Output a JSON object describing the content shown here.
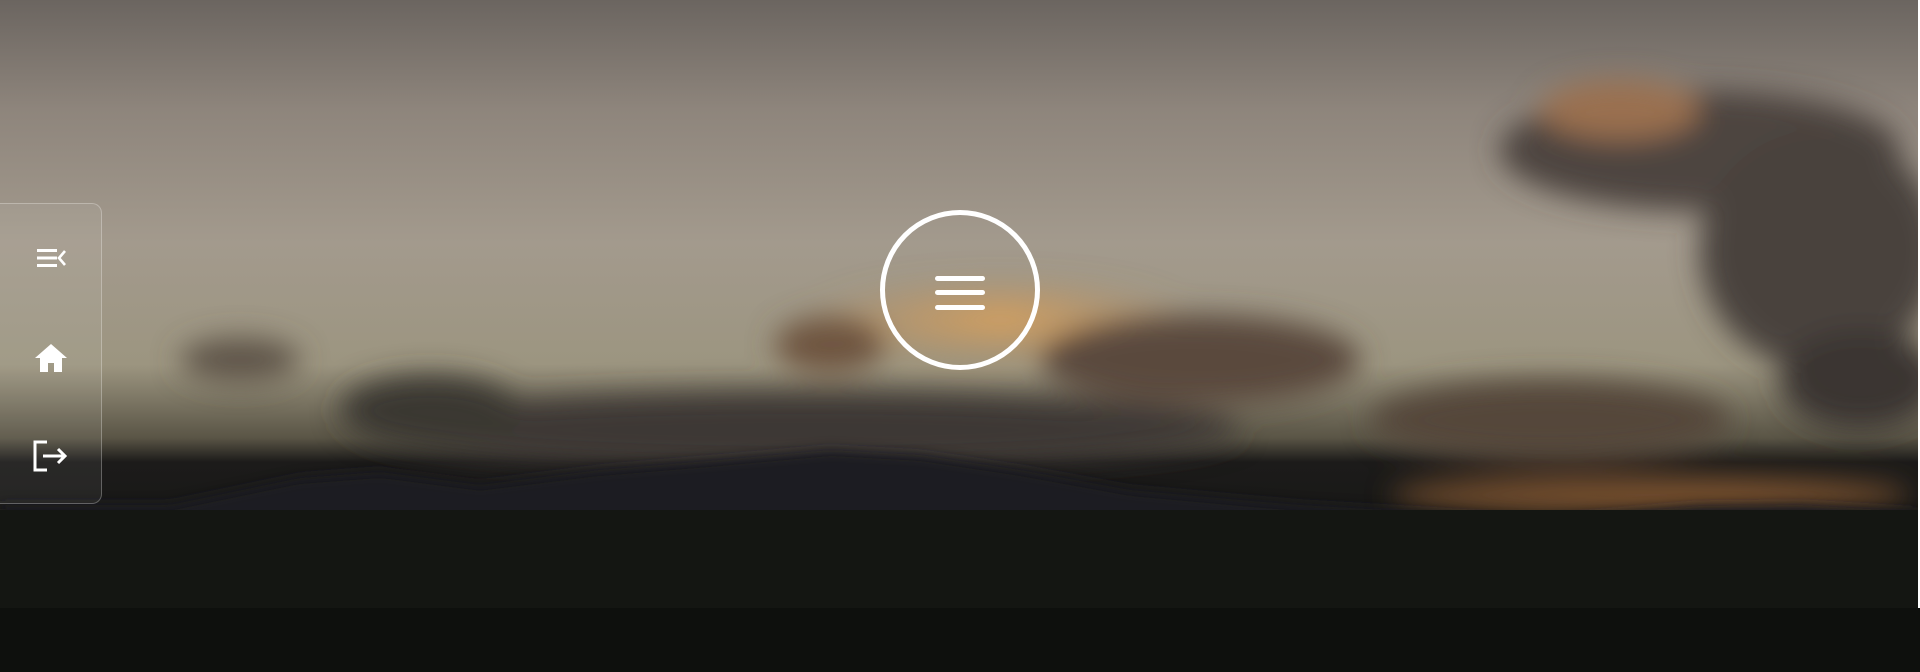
{
  "sidebar": {
    "items": [
      {
        "icon": "collapse-menu-icon"
      },
      {
        "icon": "home-icon"
      },
      {
        "icon": "logout-icon"
      }
    ]
  },
  "main_menu": {
    "icon": "hamburger-menu-icon"
  },
  "colors": {
    "icon": "#ffffff",
    "sky": "#a39a8d",
    "cloud_glow": "#d9a060",
    "ground": "#121411"
  }
}
